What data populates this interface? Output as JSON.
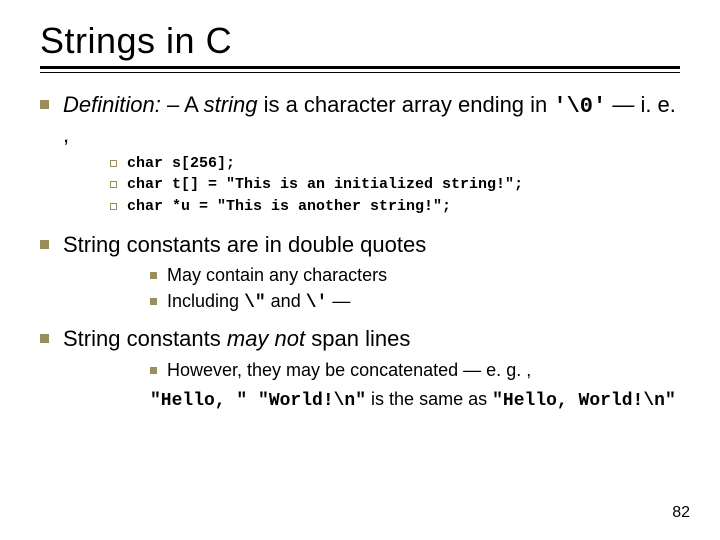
{
  "title": "Strings in C",
  "def_prefix": "Definition:",
  "def_dash": " – A ",
  "def_string_word": "string",
  "def_rest": " is a character array ending in ",
  "def_nul": "'\\0'",
  "def_ie": " — i. e. ,",
  "code1": "char s[256];",
  "code2": "char t[] = \"This is an initialized string!\";",
  "code3": "char *u = \"This is another string!\";",
  "point2": "String constants are in double quotes",
  "sub1": "May contain any characters",
  "sub2_a": "Including ",
  "sub2_b": "\\\"",
  "sub2_c": " and ",
  "sub2_d": "\\'",
  "sub2_e": " —",
  "point3_a": "String constants ",
  "point3_b": "may not",
  "point3_c": " span lines",
  "note_a": "However, they may be concatenated — e. g. ,",
  "note_code1": "\"Hello, \" \"World!\\n\"",
  "note_mid": " is the same as ",
  "note_code2": "\"Hello, World!\\n\"",
  "page": "82"
}
